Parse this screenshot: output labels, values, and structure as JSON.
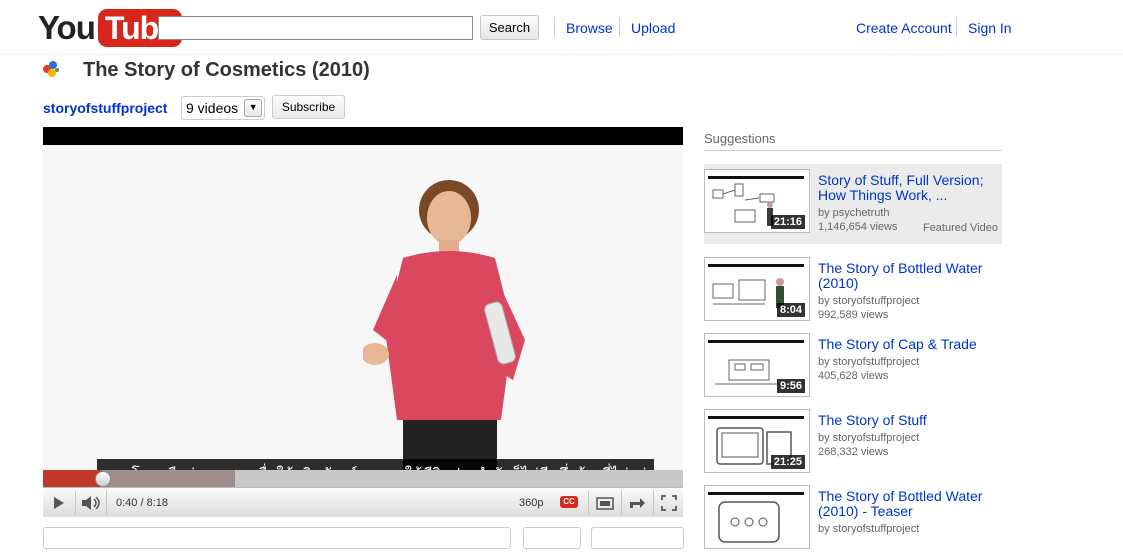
{
  "masthead": {
    "logo_you": "You",
    "logo_tube": "Tube",
    "search_button": "Search",
    "nav": {
      "browse": "Browse",
      "upload": "Upload",
      "create_account": "Create Account",
      "sign_in": "Sign In"
    }
  },
  "video": {
    "title": "The Story of Cosmetics (2010)",
    "channel": "storyofstuffproject",
    "videos_count": "9 videos",
    "subscribe": "Subscribe"
  },
  "player": {
    "subtitle": "ของโหลหรือส่วนบุคคลเพื่อให้ผลิตภัณฑ์ดูแลผมใช้ชีวิตประจำวันก็ไม่มีหนึ่งบ้างที่ไม่อยู่",
    "time": "0:40 / 8:18",
    "quality": "360p",
    "cc": "CC",
    "progress_played": 0.092,
    "progress_loaded": 0.3
  },
  "suggestions": {
    "heading": "Suggestions",
    "items": [
      {
        "title_line1": "Story of Stuff, Full Version;",
        "title_line2": "How Things Work, ...",
        "by": "by psychetruth",
        "views": "1,146,654 views",
        "duration": "21:16",
        "featured": "Featured Video"
      },
      {
        "title_line1": "The Story of Bottled Water",
        "title_line2": "(2010)",
        "by": "by storyofstuffproject",
        "views": "992,589 views",
        "duration": "8:04"
      },
      {
        "title_line1": "The Story of Cap & Trade",
        "title_line2": "",
        "by": "by storyofstuffproject",
        "views": "405,628 views",
        "duration": "9:56"
      },
      {
        "title_line1": "The Story of Stuff",
        "title_line2": "",
        "by": "by storyofstuffproject",
        "views": "268,332 views",
        "duration": "21:25"
      },
      {
        "title_line1": "The Story of Bottled Water",
        "title_line2": "(2010) - Teaser",
        "by": "by storyofstuffproject",
        "views": "",
        "duration": ""
      }
    ]
  }
}
